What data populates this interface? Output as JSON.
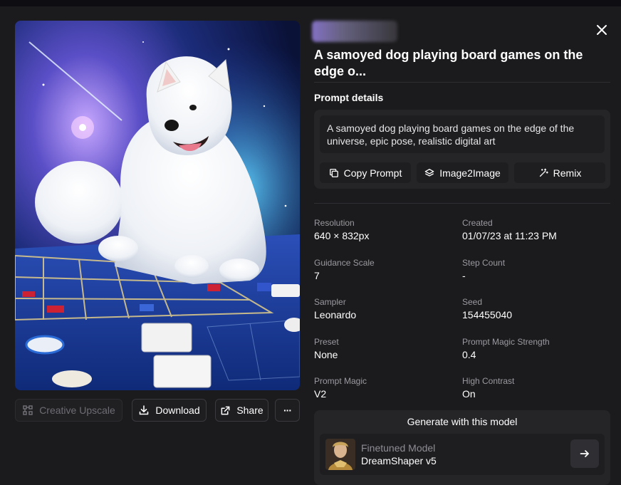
{
  "header": {
    "title": "A samoyed dog playing board games on the edge o..."
  },
  "actions": {
    "creative_upscale": "Creative Upscale",
    "download": "Download",
    "share": "Share",
    "more": "···"
  },
  "prompt": {
    "section_label": "Prompt details",
    "text": "A samoyed dog playing board games on the edge of the universe, epic pose, realistic digital art",
    "copy_label": "Copy Prompt",
    "image2image_label": "Image2Image",
    "remix_label": "Remix"
  },
  "details": [
    {
      "label": "Resolution",
      "value": "640 × 832px"
    },
    {
      "label": "Created",
      "value": "01/07/23 at 11:23 PM"
    },
    {
      "label": "Guidance Scale",
      "value": "7"
    },
    {
      "label": "Step Count",
      "value": "-"
    },
    {
      "label": "Sampler",
      "value": "Leonardo"
    },
    {
      "label": "Seed",
      "value": "154455040"
    },
    {
      "label": "Preset",
      "value": "None"
    },
    {
      "label": "Prompt Magic Strength",
      "value": "0.4"
    },
    {
      "label": "Prompt Magic",
      "value": "V2"
    },
    {
      "label": "High Contrast",
      "value": "On"
    }
  ],
  "generate": {
    "title": "Generate with this model",
    "kicker": "Finetuned Model",
    "model_name": "DreamShaper v5"
  },
  "icons": {
    "close": "close-icon",
    "upscale": "upscale-icon",
    "download": "download-icon",
    "share": "external-link-icon",
    "more": "ellipsis-icon",
    "copy": "copy-icon",
    "image2image": "layers-icon",
    "remix": "magic-wand-icon",
    "arrow": "arrow-right-icon"
  },
  "colors": {
    "background": "#1b1b1d",
    "card": "#252528",
    "inner": "#1e1e21",
    "muted": "#9a9aa0"
  }
}
